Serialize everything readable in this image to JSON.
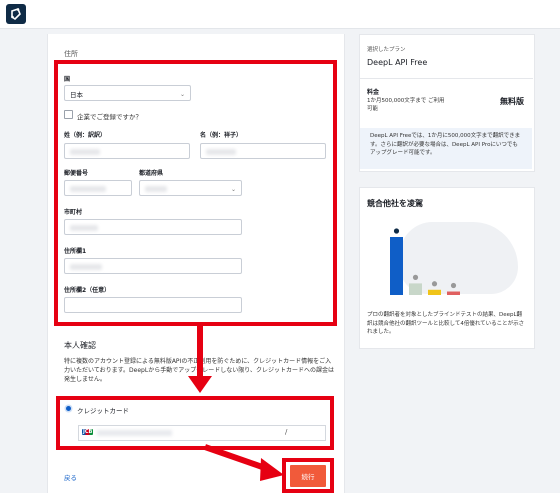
{
  "app": {
    "name": "DeepL"
  },
  "form": {
    "cut_heading": "住所",
    "country_label": "国",
    "country_value": "日本",
    "company_checkbox_label": "企業でご登録ですか？",
    "last_name_label": "姓（例：訳訳）",
    "first_name_label": "名（例：祥子）",
    "postal_label": "郵便番号",
    "prefecture_label": "都道府県",
    "city_label": "市町村",
    "address1_label": "住所欄1",
    "address2_label": "住所欄2（任意）"
  },
  "identity": {
    "title": "本人確認",
    "desc": "特に複数のアカウント登録による無料版APIの不正利用を防ぐために、クレジットカード情報をご入力いただいております。DeepLから手動でアップグレードしない限り、クレジットカードへの課金は発生しません。"
  },
  "payment": {
    "option_label": "クレジットカード",
    "card_brand": "JCB",
    "expiry_separator": "/"
  },
  "actions": {
    "back": "戻る",
    "continue": "続行"
  },
  "plan": {
    "selected_label": "選択したプラン",
    "name": "DeepL API Free",
    "fee_label": "料金",
    "fee_desc": "1か月500,000文字まで ご利用可能",
    "fee_value": "無料版",
    "note": "DeepL API Freeでは、1か月に500,000文字まで翻訳できます。さらに翻訳が必要な場合は、DeepL API Proにいつでもアップグレード可能です。"
  },
  "comparison": {
    "title": "競合他社を凌駕",
    "desc": "プロの翻訳者を対象としたブラインドテストの結果、DeepL翻訳は競合他社の翻訳ツールと比較して4倍優れていることが示されました。"
  },
  "chart_data": {
    "type": "bar",
    "categories": [
      "DeepL",
      "Google",
      "Amazon",
      "Microsoft"
    ],
    "values": [
      100,
      20,
      9,
      6
    ],
    "colors": [
      "#0f5ec7",
      "#c8d7c9",
      "#f0c419",
      "#e06060"
    ],
    "icons": [
      "deepl-logo",
      "google-logo",
      "amazon-logo",
      "microsoft-logo"
    ]
  },
  "colors": {
    "highlight": "#e60012",
    "accent": "#0f5ec7",
    "button": "#f15a3a",
    "brand_dark": "#0f2b46"
  }
}
